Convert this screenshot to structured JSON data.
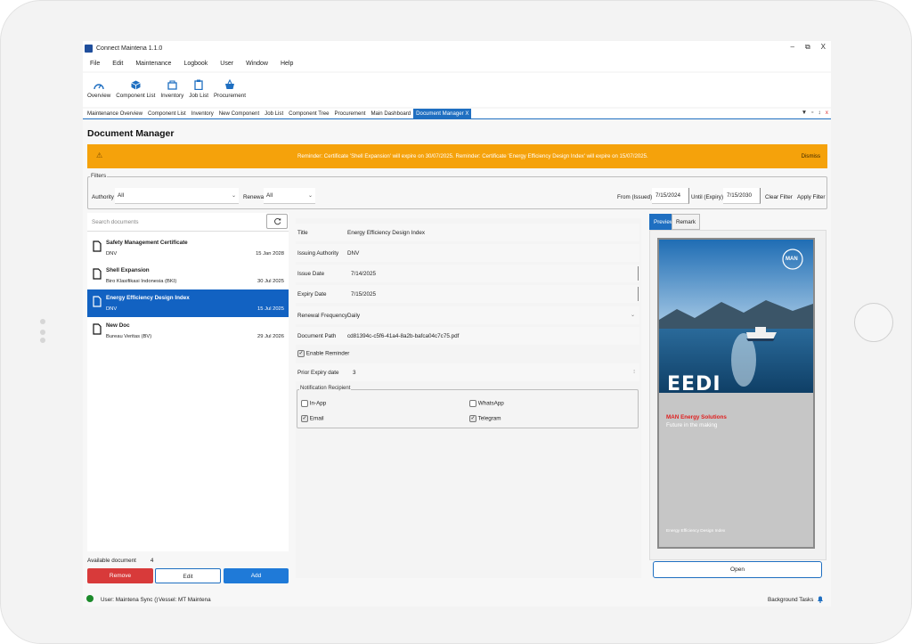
{
  "app": {
    "title": "Connect Maintena 1.1.0",
    "win_min": "–",
    "win_max": "⧉",
    "win_close": "X"
  },
  "menu": [
    "File",
    "Edit",
    "Maintenance",
    "Logbook",
    "User",
    "Window",
    "Help"
  ],
  "toolbar": [
    {
      "label": "Overview",
      "icon": "gauge-icon"
    },
    {
      "label": "Component List",
      "icon": "cube-icon"
    },
    {
      "label": "Inventory",
      "icon": "box-icon"
    },
    {
      "label": "Job List",
      "icon": "clipboard-icon"
    },
    {
      "label": "Procurement",
      "icon": "basket-icon"
    }
  ],
  "tabs": [
    "Maintenance Overview",
    "Component List",
    "Inventory",
    "New Component",
    "Job List",
    "Component Tree",
    "Procurement",
    "Main Dashboard",
    "Document Manager  X"
  ],
  "tab_tools": {
    "dropdown": "▼",
    "restore": "▫",
    "pin": "↕",
    "close": "x"
  },
  "page_title": "Document Manager",
  "banner": {
    "icon": "warning-icon",
    "message": "Reminder: Certificate 'Shell Expansion' will expire on 30/07/2025. Reminder: Certificate 'Energy Efficiency Design Index' will expire on 15/07/2025.",
    "dismiss": "Dismiss",
    "color": "#f5a20b"
  },
  "filters": {
    "title": "Filters",
    "authority_label": "Authority",
    "authority_value": "All",
    "renewal_label": "Renewal",
    "renewal_value": "All",
    "from_label": "From (Issued)",
    "from_value": "7/15/2024",
    "until_label": "Until (Expiry)",
    "until_value": "7/15/2030",
    "clear": "Clear Filter",
    "apply": "Apply Filter"
  },
  "search": {
    "placeholder": "Search documents"
  },
  "documents": [
    {
      "name": "Safety Management Certificate",
      "authority": "DNV",
      "date": "15 Jan 2028"
    },
    {
      "name": "Shell Expansion",
      "authority": "Biro Klasifikasi Indonesia (BKI)",
      "date": "30 Jul 2025"
    },
    {
      "name": "Energy Efficiency Design Index",
      "authority": "DNV",
      "date": "15 Jul 2025"
    },
    {
      "name": "New Doc",
      "authority": "Bureau Veritas (BV)",
      "date": "29 Jul 2026"
    }
  ],
  "available": {
    "label": "Available document",
    "count": "4"
  },
  "buttons": {
    "remove": "Remove",
    "edit": "Edit",
    "add": "Add",
    "open": "Open"
  },
  "form": {
    "title_label": "Title",
    "title_value": "Energy Efficiency Design Index",
    "authority_label": "Issuing Authority",
    "authority_value": "DNV",
    "issue_label": "Issue Date",
    "issue_value": "7/14/2025",
    "expiry_label": "Expiry Date",
    "expiry_value": "7/15/2025",
    "renewal_label": "Renewal Frequency",
    "renewal_value": "Daily",
    "path_label": "Document Path",
    "path_value": "cd81394c-c5f6-41a4-8a2b-bafca04c7c75.pdf",
    "reminder_label": "Enable Reminder",
    "prior_label": "Prior Expiry date",
    "prior_value": "3"
  },
  "notification": {
    "title": "Notification Recipient",
    "in_app": "In-App",
    "whatsapp": "WhatsApp",
    "email": "Email",
    "telegram": "Telegram"
  },
  "preview": {
    "tab_preview": "Preview",
    "tab_remark": "Remark",
    "cover_title": "EEDI",
    "cover_brand": "MAN Energy Solutions",
    "cover_tagline": "Future in the making",
    "cover_footer": "Energy Efficiency Design Index",
    "cover_logo": "MAN"
  },
  "status": {
    "user": "User: Maintena Sync ()",
    "vessel": "Vessel: MT Maintena",
    "background": "Background Tasks"
  }
}
